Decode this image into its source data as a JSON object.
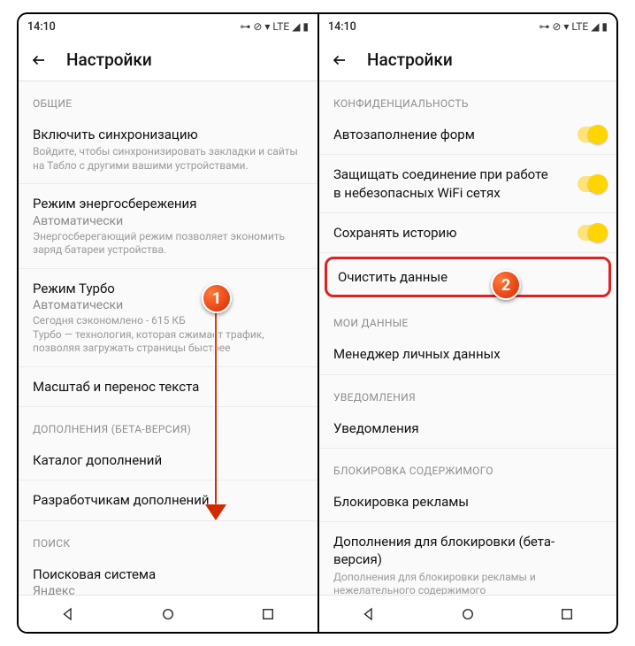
{
  "status": {
    "time": "14:10",
    "indicators": "⊶ ⊘ ▾ LTE ◢ ▮"
  },
  "header": {
    "title": "Настройки"
  },
  "left": {
    "sections": [
      {
        "header": "ОБЩИЕ",
        "rows": [
          {
            "title": "Включить синхронизацию",
            "sub": "Войдите, чтобы синхронизировать закладки и сайты на Табло с другими вашими устройствами."
          },
          {
            "title": "Режим энергосбережения",
            "value": "Автоматически",
            "sub": "Энергосберегающий режим позволяет экономить заряд батареи устройства."
          },
          {
            "title": "Режим Турбо",
            "value": "Автоматически",
            "sub": "Сегодня сэкономлено - 615 КБ\nТурбо — технология, которая сжимает трафик, позволяя загружать страницы быстрее"
          },
          {
            "title": "Масштаб и перенос текста"
          }
        ]
      },
      {
        "header": "ДОПОЛНЕНИЯ (БЕТА-ВЕРСИЯ)",
        "rows": [
          {
            "title": "Каталог дополнений"
          },
          {
            "title": "Разработчикам дополнений"
          }
        ]
      },
      {
        "header": "ПОИСК",
        "rows": [
          {
            "title": "Поисковая система",
            "value": "Яндекс"
          }
        ]
      }
    ]
  },
  "right": {
    "sections": [
      {
        "header": "КОНФИДЕНЦИАЛЬНОСТЬ",
        "rows": [
          {
            "title": "Автозаполнение форм",
            "toggle": true
          },
          {
            "title": "Защищать соединение при работе в небезопасных WiFi сетях",
            "toggle": true
          },
          {
            "title": "Сохранять историю",
            "toggle": true
          },
          {
            "title": "Очистить данные",
            "highlight": true
          }
        ]
      },
      {
        "header": "МОИ ДАННЫЕ",
        "rows": [
          {
            "title": "Менеджер личных данных"
          }
        ]
      },
      {
        "header": "УВЕДОМЛЕНИЯ",
        "rows": [
          {
            "title": "Уведомления"
          }
        ]
      },
      {
        "header": "БЛОКИРОВКА СОДЕРЖИМОГО",
        "rows": [
          {
            "title": "Блокировка рекламы"
          },
          {
            "title": "Дополнения для блокировки (бета-версия)",
            "sub": "Дополнения для блокировки рекламы и нежелательного содержимого"
          }
        ]
      }
    ]
  },
  "badges": {
    "one": "1",
    "two": "2"
  }
}
